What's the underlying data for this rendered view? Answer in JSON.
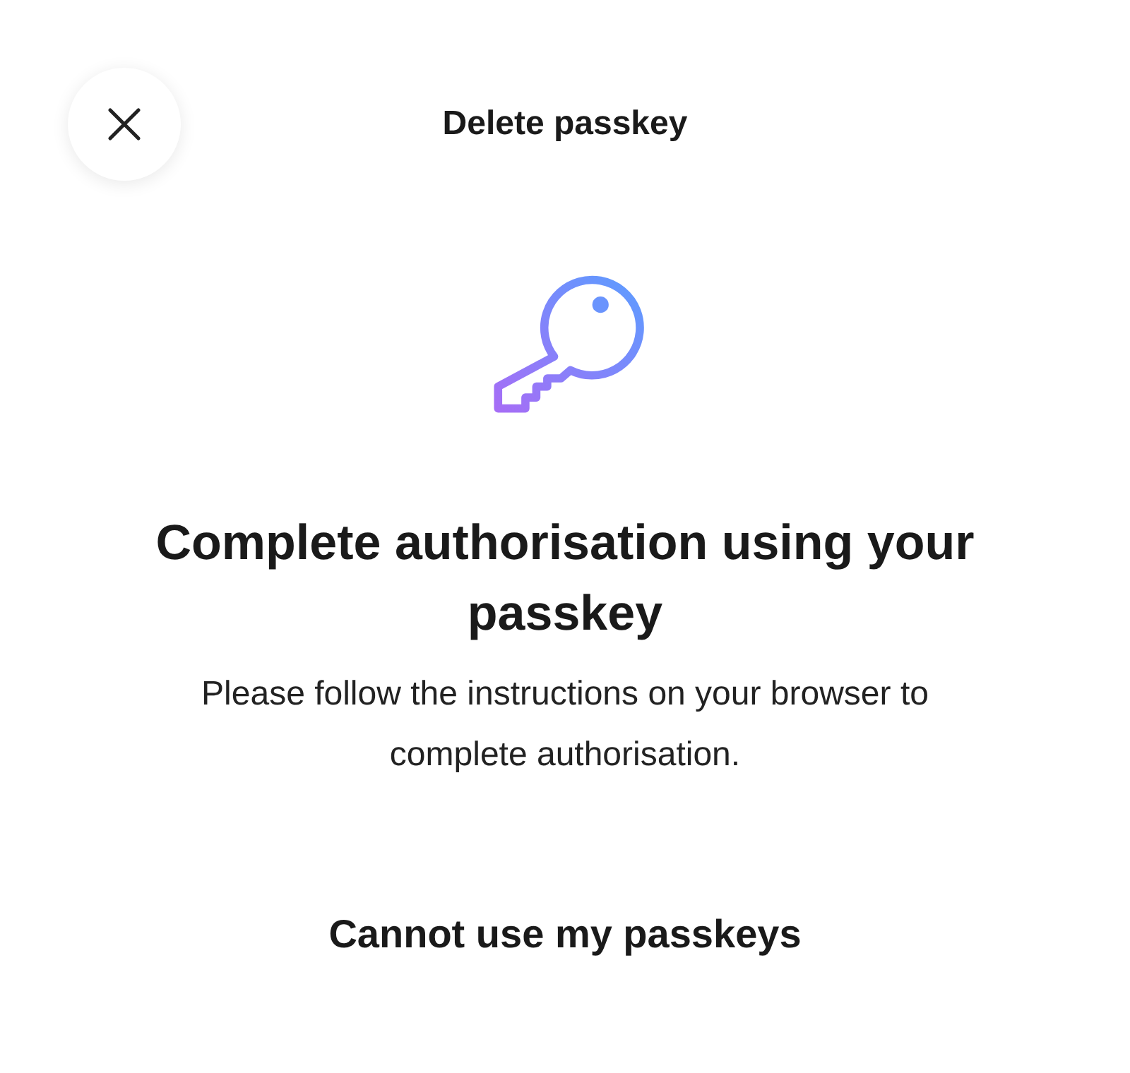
{
  "header": {
    "title": "Delete passkey"
  },
  "heading": "Complete authorisation using your passkey",
  "message": "Please follow the instructions on your browser to complete authorisation.",
  "link": "Cannot use my passkeys"
}
